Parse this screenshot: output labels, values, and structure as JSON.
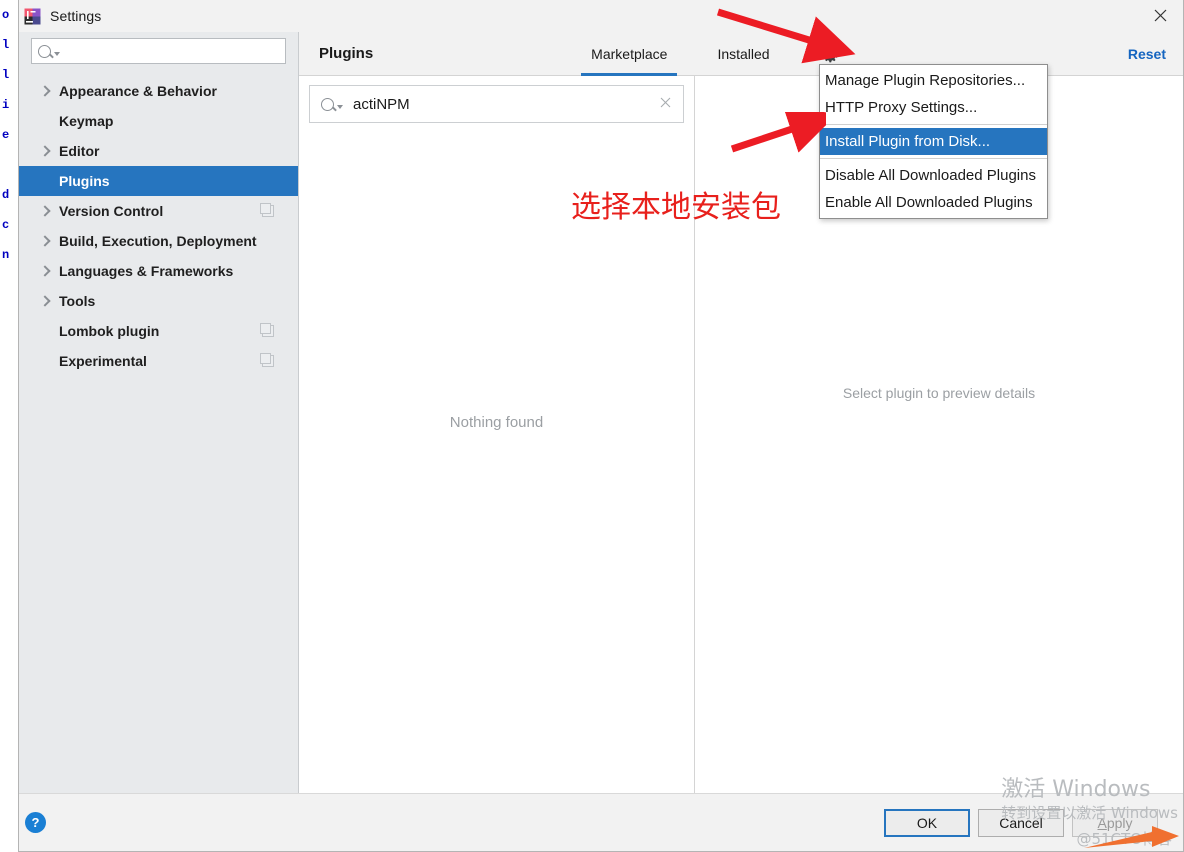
{
  "window": {
    "title": "Settings",
    "app_icon": "intellij-idea-icon",
    "close_icon": "close-icon"
  },
  "sidebar": {
    "search": {
      "value": "",
      "placeholder": "",
      "icon": "search-icon"
    },
    "items": [
      {
        "label": "Appearance & Behavior",
        "expandable": true,
        "selected": false,
        "badge": false
      },
      {
        "label": "Keymap",
        "expandable": false,
        "selected": false,
        "badge": false
      },
      {
        "label": "Editor",
        "expandable": true,
        "selected": false,
        "badge": false
      },
      {
        "label": "Plugins",
        "expandable": false,
        "selected": true,
        "badge": false
      },
      {
        "label": "Version Control",
        "expandable": true,
        "selected": false,
        "badge": true
      },
      {
        "label": "Build, Execution, Deployment",
        "expandable": true,
        "selected": false,
        "badge": false
      },
      {
        "label": "Languages & Frameworks",
        "expandable": true,
        "selected": false,
        "badge": false
      },
      {
        "label": "Tools",
        "expandable": true,
        "selected": false,
        "badge": false
      },
      {
        "label": "Lombok plugin",
        "expandable": false,
        "selected": false,
        "badge": true
      },
      {
        "label": "Experimental",
        "expandable": false,
        "selected": false,
        "badge": true
      }
    ]
  },
  "content": {
    "title": "Plugins",
    "tabs": [
      {
        "label": "Marketplace",
        "active": true
      },
      {
        "label": "Installed",
        "active": false
      }
    ],
    "gear_icon": "gear-icon",
    "reset_label": "Reset",
    "plugin_search": {
      "value": "actiNPM",
      "icon": "search-icon",
      "clear_icon": "close-icon"
    },
    "empty_list_text": "Nothing found",
    "preview_hint": "Select plugin to preview details"
  },
  "menu": {
    "items": [
      {
        "label": "Manage Plugin Repositories...",
        "highlight": false,
        "separator_after": false
      },
      {
        "label": "HTTP Proxy Settings...",
        "highlight": false,
        "separator_after": true
      },
      {
        "label": "Install Plugin from Disk...",
        "highlight": true,
        "separator_after": true
      },
      {
        "label": "Disable All Downloaded Plugins",
        "highlight": false,
        "separator_after": false
      },
      {
        "label": "Enable All Downloaded Plugins",
        "highlight": false,
        "separator_after": false
      }
    ]
  },
  "footer": {
    "help_icon": "help-icon",
    "ok_label": "OK",
    "cancel_label": "Cancel",
    "apply_label": "Apply",
    "apply_disabled": true
  },
  "annotations": {
    "note_cn": "选择本地安装包",
    "note_color": "#e8201c",
    "arrow_color": "#e8201c",
    "arrow_to_gear": "arrow-icon",
    "arrow_to_install_from_disk": "arrow-icon"
  },
  "watermark": {
    "activate_line1": "激活 Windows",
    "activate_line2": "转到设置以激活 Windows",
    "site": "@51CTO博客"
  },
  "background_editor": {
    "lines": [
      "o",
      "l",
      "l",
      "i",
      "e",
      "",
      "d",
      "c",
      "n"
    ]
  },
  "colors": {
    "accent": "#2675bf",
    "link": "#1565c0",
    "sidebar_bg": "#e8eaec",
    "dialog_bg": "#f2f2f2",
    "annotation_red": "#e8201c",
    "watermark_gray": "#b9bcbf"
  }
}
